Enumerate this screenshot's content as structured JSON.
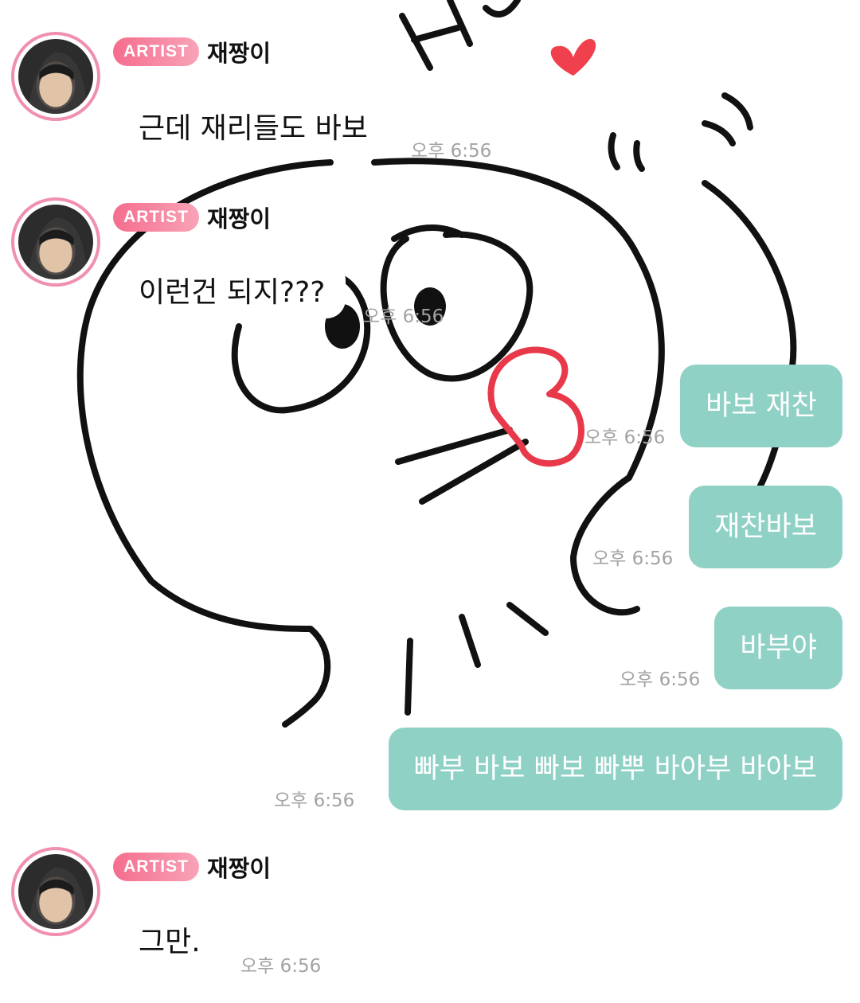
{
  "sender": {
    "badge": "ARTIST",
    "name": "재짱이"
  },
  "messages": [
    {
      "direction": "incoming",
      "text": "근데 재리들도 바보",
      "time": "오후 6:56"
    },
    {
      "direction": "incoming",
      "text": "이런건 되지???",
      "time": "오후 6:56"
    },
    {
      "direction": "outgoing",
      "text": "바보 재찬",
      "time": "오후 6:56"
    },
    {
      "direction": "outgoing",
      "text": "재찬바보",
      "time": "오후 6:56"
    },
    {
      "direction": "outgoing",
      "text": "바부야",
      "time": "오후 6:56"
    },
    {
      "direction": "outgoing",
      "text": "빠부 바보 빠보 빠뿌 바아부 바아보",
      "time": "오후 6:56"
    },
    {
      "direction": "incoming",
      "text": "그만.",
      "time": "오후 6:56"
    }
  ],
  "colors": {
    "outgoing_bubble": "#8fd1c5",
    "badge": "#f56d8e",
    "avatar_ring": "#f08fb0",
    "timestamp": "#a3a3a3",
    "sticker_heart": "#f0404e",
    "sticker_lips": "#e8394a"
  },
  "sticker": {
    "icon": "kissing-face-sticker",
    "text": "Hi"
  }
}
